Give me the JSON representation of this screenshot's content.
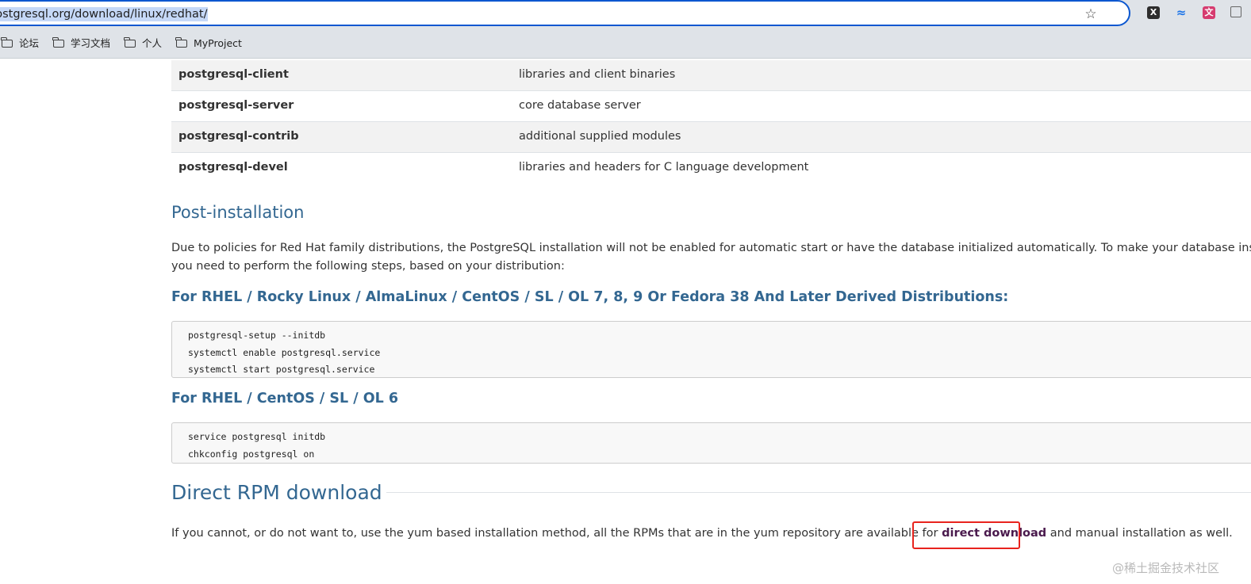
{
  "browser": {
    "url": "postgresql.org/download/linux/redhat/",
    "bookmarks": [
      "论坛",
      "学习文档",
      "个人",
      "MyProject"
    ],
    "extensions": {
      "ext1": "X",
      "ext2": "≈",
      "ext3": "文"
    }
  },
  "packages": [
    {
      "name": "postgresql-client",
      "desc": "libraries and client binaries"
    },
    {
      "name": "postgresql-server",
      "desc": "core database server"
    },
    {
      "name": "postgresql-contrib",
      "desc": "additional supplied modules"
    },
    {
      "name": "postgresql-devel",
      "desc": "libraries and headers for C language development"
    }
  ],
  "post_install": {
    "heading": "Post-installation",
    "para_line1": "Due to policies for Red Hat family distributions, the PostgreSQL installation will not be enabled for automatic start or have the database initialized automatically. To make your database installa",
    "para_line2": "you need to perform the following steps, based on your distribution:",
    "sub1": "For RHEL / Rocky Linux / AlmaLinux / CentOS / SL / OL 7, 8, 9 Or Fedora 38 And Later Derived Distributions:",
    "code1": [
      "postgresql-setup --initdb",
      "systemctl enable postgresql.service",
      "systemctl start postgresql.service"
    ],
    "sub2": "For RHEL / CentOS / SL / OL 6",
    "code2": [
      "service postgresql initdb",
      "chkconfig postgresql on"
    ]
  },
  "direct": {
    "heading": "Direct RPM download",
    "text_before": "If you cannot, or do not want to, use the yum based installation method, all the RPMs that are in the yum repository are available for ",
    "link": "direct download",
    "text_after": " and manual installation as well."
  },
  "watermark": "@稀土掘金技术社区",
  "colors": {
    "heading": "#336791",
    "link": "#4a1a4d",
    "highlight_box": "#e8231d",
    "omnibox_border": "#0b57d0"
  }
}
